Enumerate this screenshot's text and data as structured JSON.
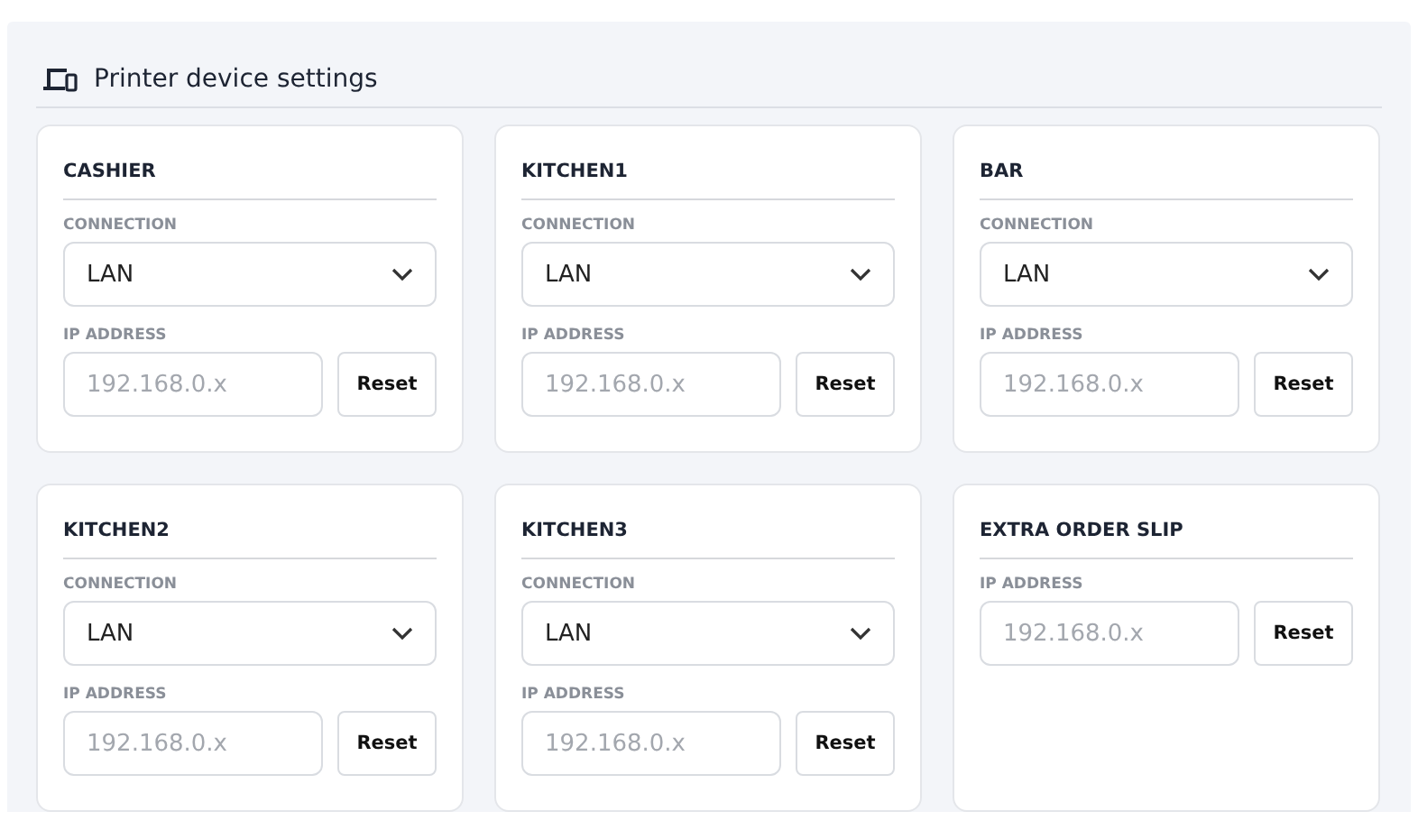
{
  "panel": {
    "title": "Printer device settings"
  },
  "printers": [
    {
      "name": "CASHIER",
      "fields": [
        {
          "kind": "select",
          "label": "CONNECTION",
          "value": "LAN"
        },
        {
          "kind": "ip",
          "label": "IP ADDRESS",
          "placeholder": "192.168.0.x",
          "button": "Reset"
        }
      ]
    },
    {
      "name": "KITCHEN1",
      "fields": [
        {
          "kind": "select",
          "label": "CONNECTION",
          "value": "LAN"
        },
        {
          "kind": "ip",
          "label": "IP ADDRESS",
          "placeholder": "192.168.0.x",
          "button": "Reset"
        }
      ]
    },
    {
      "name": "BAR",
      "fields": [
        {
          "kind": "select",
          "label": "CONNECTION",
          "value": "LAN"
        },
        {
          "kind": "ip",
          "label": "IP ADDRESS",
          "placeholder": "192.168.0.x",
          "button": "Reset"
        }
      ]
    },
    {
      "name": "KITCHEN2",
      "fields": [
        {
          "kind": "select",
          "label": "CONNECTION",
          "value": "LAN"
        },
        {
          "kind": "ip",
          "label": "IP ADDRESS",
          "placeholder": "192.168.0.x",
          "button": "Reset"
        }
      ]
    },
    {
      "name": "KITCHEN3",
      "fields": [
        {
          "kind": "select",
          "label": "CONNECTION",
          "value": "LAN"
        },
        {
          "kind": "ip",
          "label": "IP ADDRESS",
          "placeholder": "192.168.0.x",
          "button": "Reset"
        }
      ]
    },
    {
      "name": "EXTRA ORDER SLIP",
      "fields": [
        {
          "kind": "ip",
          "label": "IP ADDRESS",
          "placeholder": "192.168.0.x",
          "button": "Reset"
        }
      ]
    }
  ]
}
